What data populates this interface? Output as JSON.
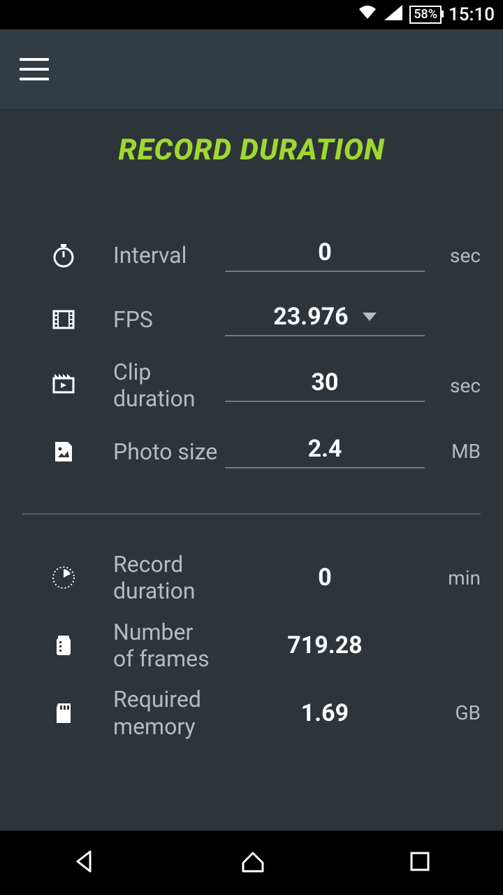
{
  "status": {
    "battery": "58%",
    "time": "15:10"
  },
  "title": "RECORD DURATION",
  "inputs": {
    "interval": {
      "label": "Interval",
      "value": "0",
      "unit": "sec"
    },
    "fps": {
      "label": "FPS",
      "value": "23.976"
    },
    "clip_duration": {
      "label": "Clip duration",
      "value": "30",
      "unit": "sec"
    },
    "photo_size": {
      "label": "Photo size",
      "value": "2.4",
      "unit": "MB"
    }
  },
  "outputs": {
    "record_duration": {
      "label": "Record duration",
      "value": "0",
      "unit": "min"
    },
    "frames": {
      "label": "Number of frames",
      "value": "719.28"
    },
    "memory": {
      "label": "Required memory",
      "value": "1.69",
      "unit": "GB"
    }
  }
}
